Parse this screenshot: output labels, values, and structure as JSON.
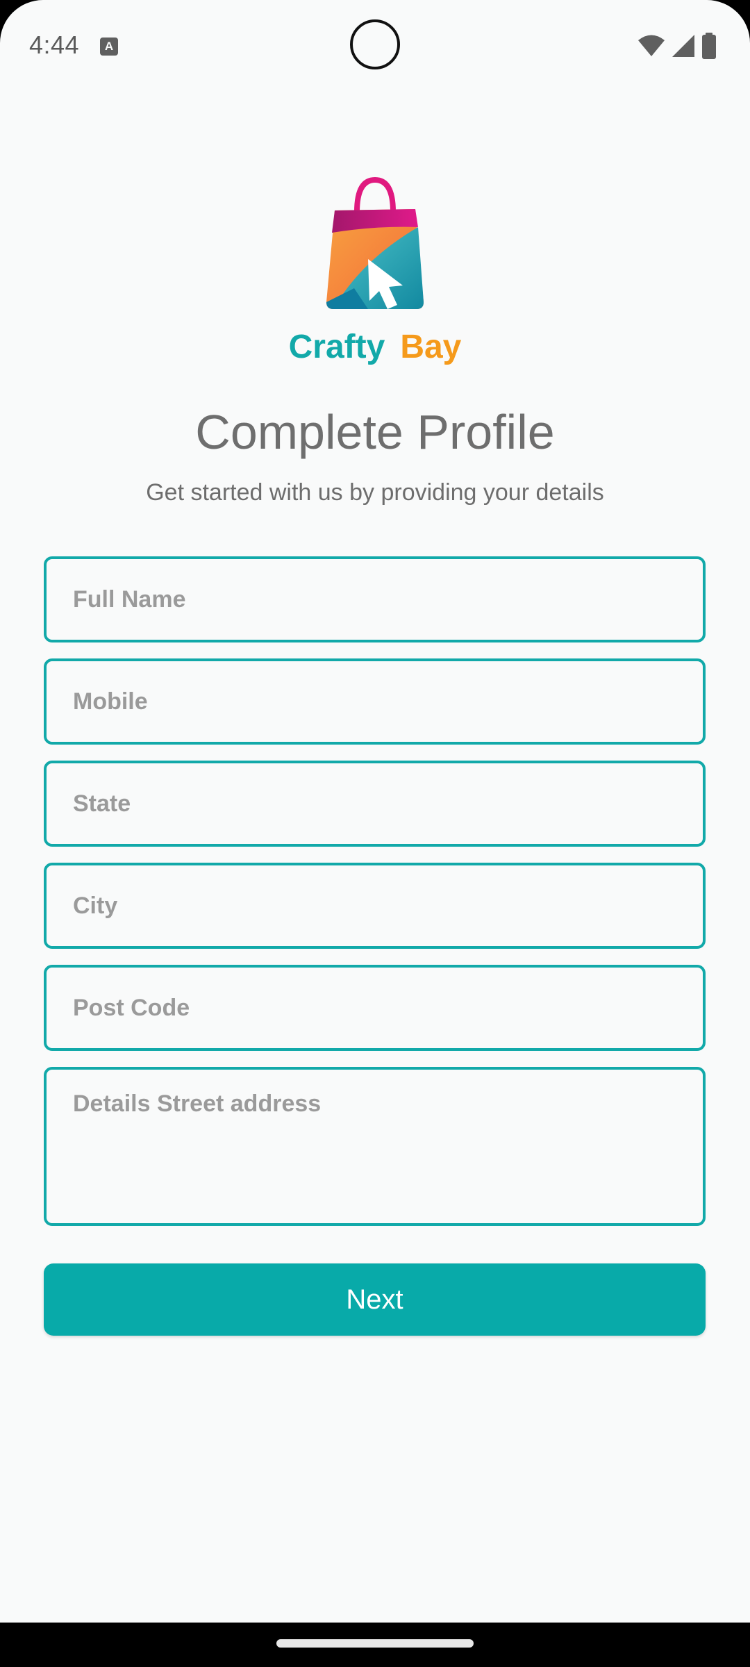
{
  "status_bar": {
    "time": "4:44",
    "notification_icon": "A"
  },
  "brand": {
    "name_part1": "Crafty",
    "name_part2": "Bay",
    "color_primary": "#12a9a9",
    "color_secondary": "#f59a1b"
  },
  "header": {
    "title": "Complete Profile",
    "subtitle": "Get started with us by providing your details"
  },
  "form": {
    "full_name": {
      "placeholder": "Full Name",
      "value": ""
    },
    "mobile": {
      "placeholder": "Mobile",
      "value": ""
    },
    "state": {
      "placeholder": "State",
      "value": ""
    },
    "city": {
      "placeholder": "City",
      "value": ""
    },
    "post_code": {
      "placeholder": "Post Code",
      "value": ""
    },
    "street_address": {
      "placeholder": "Details Street address",
      "value": ""
    }
  },
  "next_button": {
    "label": "Next"
  },
  "colors": {
    "accent": "#08aaa9",
    "background": "#f9fafa",
    "title_text": "#6e6e6e"
  }
}
